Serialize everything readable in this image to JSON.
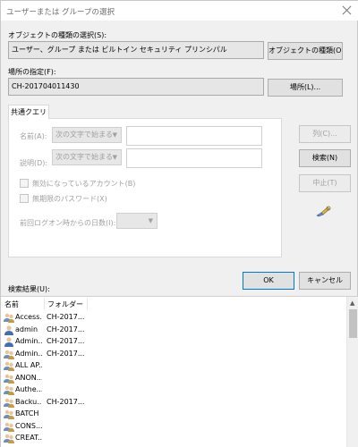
{
  "window": {
    "title": "ユーザーまたは グループの選択"
  },
  "object_type": {
    "label": "オブジェクトの種類の選択(S):",
    "value": "ユーザー、グループ または ビルトイン セキュリティ プリンシパル",
    "button": "オブジェクトの種類(O)..."
  },
  "location": {
    "label": "場所の指定(F):",
    "value": "CH-201704011430",
    "button": "場所(L)..."
  },
  "common_query": {
    "tab": "共通クエリ",
    "name_label": "名前(A):",
    "name_condition": "次の文字で始まる",
    "description_label": "説明(D):",
    "description_condition": "次の文字で始まる",
    "disabled_accounts": "無効になっているアカウント(B)",
    "non_expiring_password": "無期限のパスワード(X)",
    "days_since_logon": "前回ログオン時からの日数(I):"
  },
  "side_buttons": {
    "columns": "列(C)...",
    "find_now": "検索(N)",
    "stop": "中止(T)"
  },
  "dialog_buttons": {
    "ok": "OK",
    "cancel": "キャンセル"
  },
  "results": {
    "label": "検索結果(U):",
    "columns": [
      "名前",
      "フォルダー"
    ],
    "rows": [
      {
        "name": "Access...",
        "folder": "CH-2017...",
        "icon": "group-icon"
      },
      {
        "name": "admin",
        "folder": "CH-2017...",
        "icon": "user-icon"
      },
      {
        "name": "Admin...",
        "folder": "CH-2017...",
        "icon": "user-icon"
      },
      {
        "name": "Admin...",
        "folder": "CH-2017...",
        "icon": "group-icon"
      },
      {
        "name": "ALL AP...",
        "folder": "",
        "icon": "group-icon"
      },
      {
        "name": "ANON...",
        "folder": "",
        "icon": "group-icon"
      },
      {
        "name": "Authe...",
        "folder": "",
        "icon": "group-icon"
      },
      {
        "name": "Backu...",
        "folder": "CH-2017...",
        "icon": "group-icon"
      },
      {
        "name": "BATCH",
        "folder": "",
        "icon": "group-icon"
      },
      {
        "name": "CONS...",
        "folder": "",
        "icon": "group-icon"
      },
      {
        "name": "CREAT...",
        "folder": "",
        "icon": "group-icon"
      }
    ]
  },
  "colors": {
    "user_icon": "#3f6fb4",
    "group_icon_a": "#6a8fbf",
    "group_icon_b": "#c49a45",
    "default_button_border": "#0078d7"
  }
}
